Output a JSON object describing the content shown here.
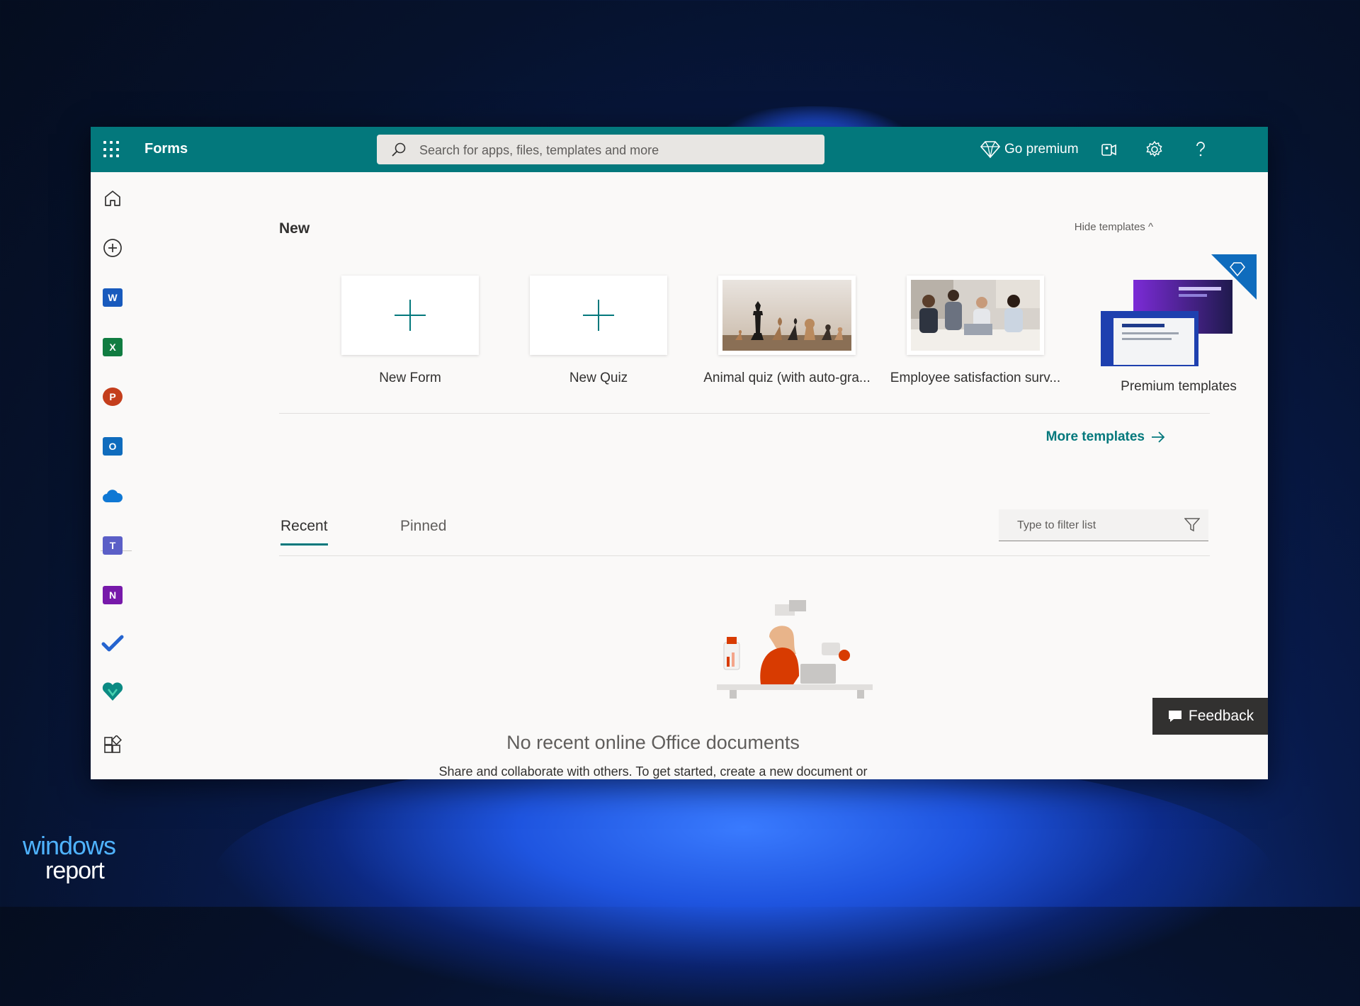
{
  "app": {
    "name": "Forms"
  },
  "search": {
    "placeholder": "Search for apps, files, templates and more"
  },
  "header": {
    "premium_label": "Go premium"
  },
  "new_section": {
    "title": "New",
    "hide_templates_label": "Hide templates ^",
    "cards": [
      {
        "label": "New Form"
      },
      {
        "label": "New Quiz"
      },
      {
        "label": "Animal quiz (with auto-gra..."
      },
      {
        "label": "Employee satisfaction surv..."
      },
      {
        "label": "Premium templates"
      }
    ],
    "more_templates_label": "More templates"
  },
  "tabs": [
    {
      "label": "Recent"
    },
    {
      "label": "Pinned"
    }
  ],
  "filter": {
    "placeholder": "Type to filter list"
  },
  "empty_state": {
    "title": "No recent online Office documents",
    "subtitle": "Share and collaborate with others. To get started, create a new document or"
  },
  "feedback": {
    "label": "Feedback"
  },
  "watermark": {
    "line1": "windows",
    "line2": "report"
  },
  "colors": {
    "brand": "#03787c",
    "background": "#faf9f8"
  },
  "icons": {
    "rail": [
      "home-icon",
      "create-icon",
      "word-icon",
      "excel-icon",
      "powerpoint-icon",
      "outlook-icon",
      "onedrive-icon",
      "teams-icon",
      "onenote-icon",
      "todo-icon",
      "viva-icon",
      "all-apps-icon"
    ],
    "header": [
      "waffle-icon",
      "search-icon",
      "diamond-icon",
      "teams-meeting-icon",
      "settings-icon",
      "help-icon"
    ]
  }
}
